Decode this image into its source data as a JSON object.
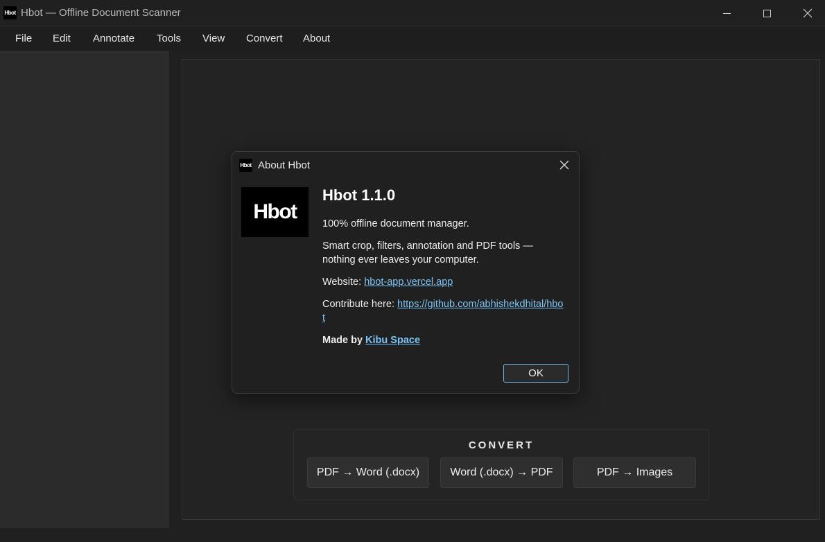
{
  "window": {
    "title": "Hbot — Offline Document Scanner",
    "icon_text": "Hbot"
  },
  "menu": [
    "File",
    "Edit",
    "Annotate",
    "Tools",
    "View",
    "Convert",
    "About"
  ],
  "canvas": {
    "partial_hint": "t"
  },
  "convert_panel": {
    "title": "CONVERT",
    "buttons": [
      "PDF → Word (.docx)",
      "Word (.docx) → PDF",
      "PDF → Images"
    ]
  },
  "dialog": {
    "title": "About Hbot",
    "icon_text": "Hbot",
    "logo_text": "Hbot",
    "heading": "Hbot 1.1.0",
    "tagline": "100% offline document manager.",
    "description": "Smart crop, filters, annotation and PDF tools — nothing ever leaves your computer.",
    "website_label": "Website: ",
    "website_link": "hbot-app.vercel.app",
    "contribute_label": "Contribute here: ",
    "contribute_link": "https://github.com/abhishekdhital/hbot",
    "made_by_label": "Made by ",
    "made_by_link": "Kibu Space",
    "ok_label": "OK"
  },
  "colors": {
    "background": "#202020",
    "link": "#7cc4f5",
    "accent_border": "#6fb8e8"
  },
  "icons": {
    "close": "close-icon",
    "minimize": "minimize-icon",
    "maximize": "maximize-icon"
  }
}
